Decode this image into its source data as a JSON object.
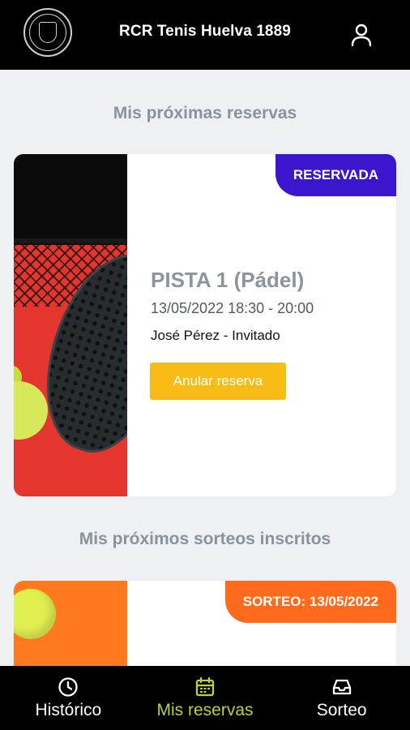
{
  "header": {
    "title": "RCR Tenis Huelva 1889",
    "logo": "club-crest-logo",
    "user_icon": "user-icon"
  },
  "sections": {
    "reservations_title": "Mis próximas reservas",
    "draws_title": "Mis próximos sorteos inscritos"
  },
  "reservation": {
    "status": "RESERVADA",
    "court": "PISTA 1 (Pádel)",
    "datetime": "13/05/2022 18:30 - 20:00",
    "players": "José Pérez - Invitado",
    "cancel_label": "Anular reserva",
    "status_color": "#3c16cf",
    "button_color": "#f9bc17"
  },
  "draw": {
    "status": "SORTEO: 13/05/2022",
    "status_color": "#ff6a1c"
  },
  "nav": {
    "items": [
      {
        "label": "Histórico",
        "icon": "clock-icon"
      },
      {
        "label": "Mis reservas",
        "icon": "calendar-icon",
        "active": true
      },
      {
        "label": "Sorteo",
        "icon": "inbox-icon"
      }
    ],
    "active_color": "#b6d636"
  }
}
